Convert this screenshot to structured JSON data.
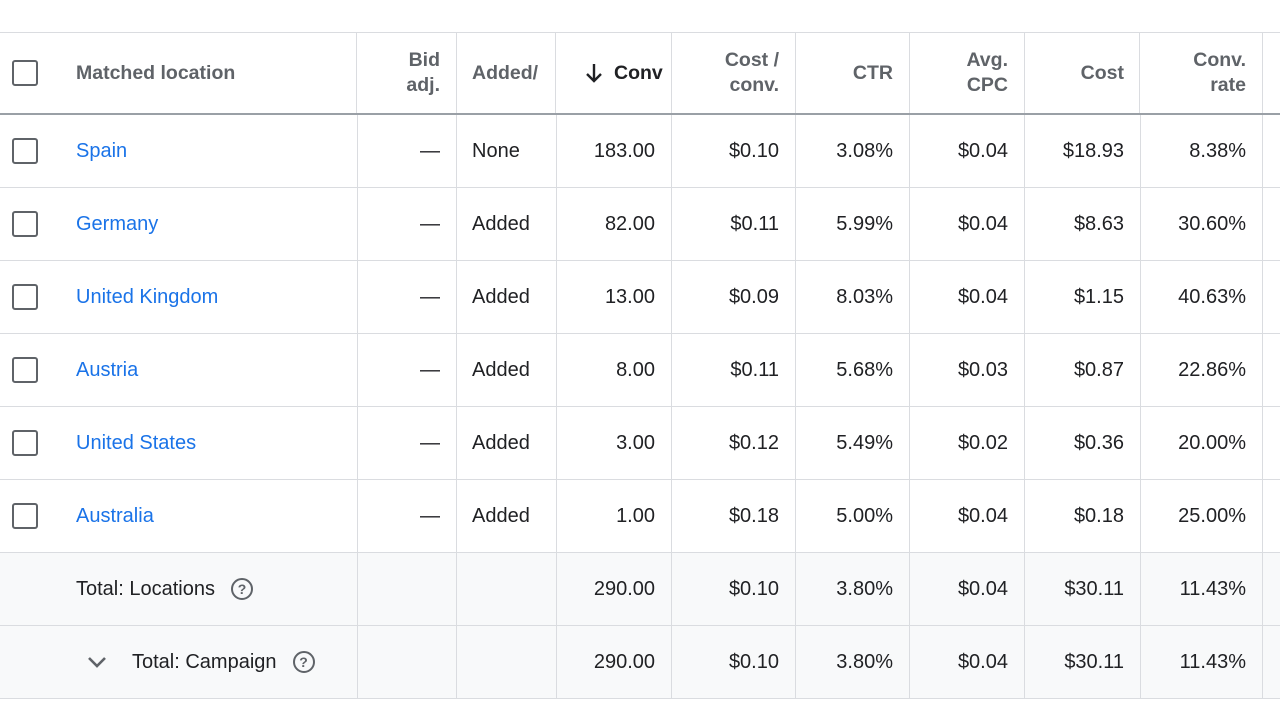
{
  "columns": {
    "matched_location": "Matched location",
    "bid_adj_line1": "Bid",
    "bid_adj_line2": "adj.",
    "added_excluded": "Added/",
    "conversions": "Conv",
    "cost_per_conv_line1": "Cost /",
    "cost_per_conv_line2": "conv.",
    "ctr": "CTR",
    "avg_cpc_line1": "Avg.",
    "avg_cpc_line2": "CPC",
    "cost": "Cost",
    "conv_rate_line1": "Conv.",
    "conv_rate_line2": "rate"
  },
  "sort": {
    "column": "conversions",
    "direction": "descending",
    "icon": "arrow-down-icon"
  },
  "rows": [
    {
      "location": "Spain",
      "bid_adj": "—",
      "added": "None",
      "conversions": "183.00",
      "cost_per_conv": "$0.10",
      "ctr": "3.08%",
      "avg_cpc": "$0.04",
      "cost": "$18.93",
      "conv_rate": "8.38%"
    },
    {
      "location": "Germany",
      "bid_adj": "—",
      "added": "Added",
      "conversions": "82.00",
      "cost_per_conv": "$0.11",
      "ctr": "5.99%",
      "avg_cpc": "$0.04",
      "cost": "$8.63",
      "conv_rate": "30.60%"
    },
    {
      "location": "United Kingdom",
      "bid_adj": "—",
      "added": "Added",
      "conversions": "13.00",
      "cost_per_conv": "$0.09",
      "ctr": "8.03%",
      "avg_cpc": "$0.04",
      "cost": "$1.15",
      "conv_rate": "40.63%"
    },
    {
      "location": "Austria",
      "bid_adj": "—",
      "added": "Added",
      "conversions": "8.00",
      "cost_per_conv": "$0.11",
      "ctr": "5.68%",
      "avg_cpc": "$0.03",
      "cost": "$0.87",
      "conv_rate": "22.86%"
    },
    {
      "location": "United States",
      "bid_adj": "—",
      "added": "Added",
      "conversions": "3.00",
      "cost_per_conv": "$0.12",
      "ctr": "5.49%",
      "avg_cpc": "$0.02",
      "cost": "$0.36",
      "conv_rate": "20.00%"
    },
    {
      "location": "Australia",
      "bid_adj": "—",
      "added": "Added",
      "conversions": "1.00",
      "cost_per_conv": "$0.18",
      "ctr": "5.00%",
      "avg_cpc": "$0.04",
      "cost": "$0.18",
      "conv_rate": "25.00%"
    }
  ],
  "totals": [
    {
      "label": "Total: Locations",
      "expandable": false,
      "conversions": "290.00",
      "cost_per_conv": "$0.10",
      "ctr": "3.80%",
      "avg_cpc": "$0.04",
      "cost": "$30.11",
      "conv_rate": "11.43%"
    },
    {
      "label": "Total: Campaign",
      "expandable": true,
      "conversions": "290.00",
      "cost_per_conv": "$0.10",
      "ctr": "3.80%",
      "avg_cpc": "$0.04",
      "cost": "$30.11",
      "conv_rate": "11.43%"
    }
  ],
  "colors": {
    "link": "#1a73e8",
    "header_text": "#5f6368",
    "text": "#202124",
    "border": "#dadce0",
    "total_bg": "#f8f9fa"
  }
}
